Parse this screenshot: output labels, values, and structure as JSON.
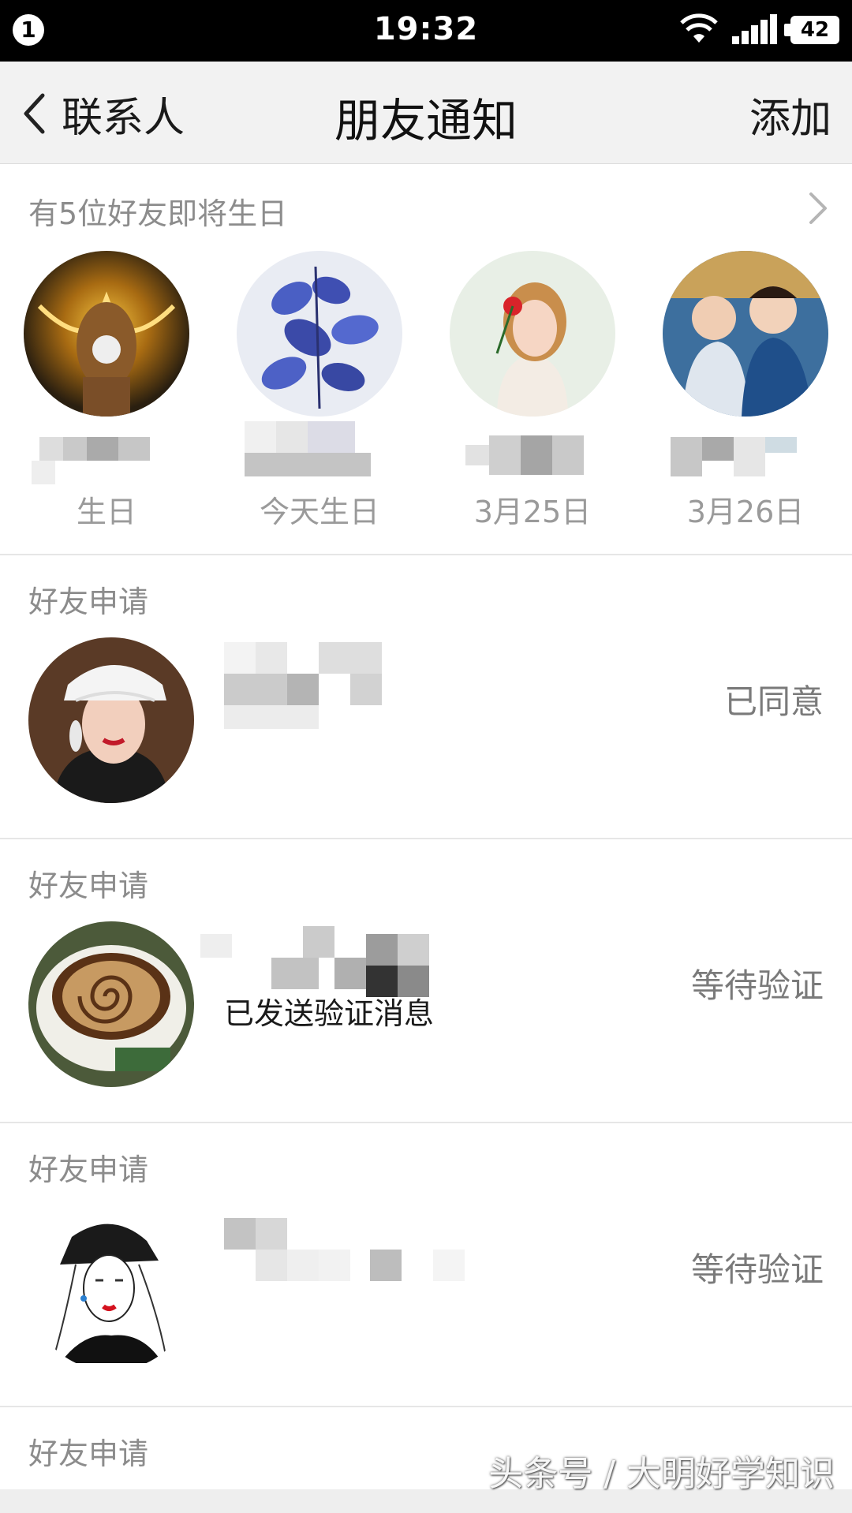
{
  "status_bar": {
    "notification_count": "1",
    "time": "19:32",
    "battery": "42"
  },
  "nav": {
    "back_label": "联系人",
    "title": "朋友通知",
    "add_label": "添加"
  },
  "birthday": {
    "header": "有5位好友即将生日",
    "items": [
      {
        "date": "生日"
      },
      {
        "date": "今天生日"
      },
      {
        "date": "3月25日"
      },
      {
        "date": "3月26日"
      }
    ]
  },
  "requests": [
    {
      "label": "好友申请",
      "subtitle": "",
      "status": "已同意"
    },
    {
      "label": "好友申请",
      "subtitle": "已发送验证消息",
      "status": "等待验证"
    },
    {
      "label": "好友申请",
      "subtitle": "",
      "status": "等待验证"
    },
    {
      "label": "好友申请",
      "subtitle": "",
      "status": ""
    }
  ],
  "watermark": "头条号 / 大明好学知识"
}
